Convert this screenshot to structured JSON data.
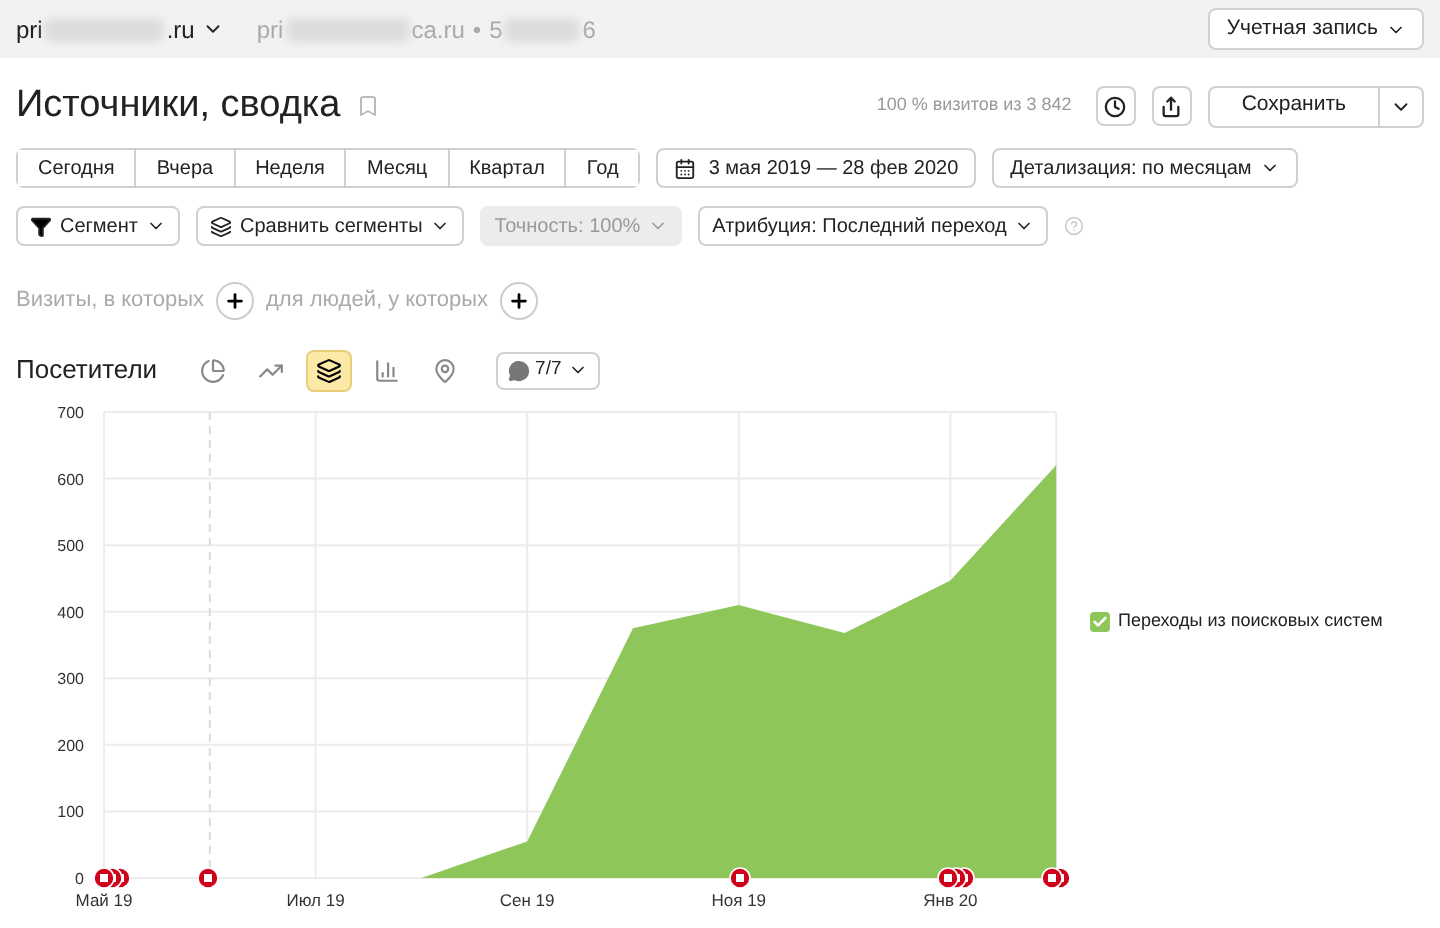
{
  "top_bar": {
    "site": {
      "prefix": "pri",
      "suffix": ".ru"
    },
    "other_site": {
      "prefix": "pri",
      "suffix": "ca.ru",
      "separator": "•",
      "id_prefix": "5",
      "id_suffix": "6"
    },
    "account_button": "Учетная запись"
  },
  "header": {
    "title": "Источники, сводка",
    "visits_info": "100 % визитов из 3 842",
    "save_button": "Сохранить"
  },
  "periods": [
    {
      "label": "Сегодня",
      "selected": false
    },
    {
      "label": "Вчера",
      "selected": false
    },
    {
      "label": "Неделя",
      "selected": false
    },
    {
      "label": "Месяц",
      "selected": false
    },
    {
      "label": "Квартал",
      "selected": false
    },
    {
      "label": "Год",
      "selected": false
    }
  ],
  "date_range": "3 мая 2019 — 28 фев 2020",
  "detail_dropdown": "Детализация: по месяцам",
  "filters": [
    {
      "label": "Сегмент",
      "disabled": false
    },
    {
      "label": "Сравнить сегменты",
      "disabled": false
    },
    {
      "label": "Точность: 100%",
      "disabled": true
    },
    {
      "label": "Атрибуция: Последний переход",
      "disabled": false
    }
  ],
  "segment_builder": {
    "visits_label": "Визиты, в которых",
    "people_label": "для людей, у которых"
  },
  "chart_toolbar": {
    "title": "Посетители",
    "views": [
      {
        "kind": "pie",
        "selected": false
      },
      {
        "kind": "line",
        "selected": false
      },
      {
        "kind": "area",
        "selected": true
      },
      {
        "kind": "bar",
        "selected": false
      },
      {
        "kind": "map",
        "selected": false
      }
    ],
    "notes_count": "7/7"
  },
  "chart": {
    "chart_data": {
      "type": "area",
      "categories": [
        "Май 19",
        null,
        "Июл 19",
        null,
        "Сен 19",
        null,
        "Ноя 19",
        null,
        "Янв 20",
        null
      ],
      "series": [
        {
          "name": "Переходы из поисковых систем",
          "color": "#8fc65a",
          "values": [
            null,
            null,
            null,
            0,
            55,
            375,
            410,
            368,
            447,
            620
          ]
        }
      ],
      "ylim": [
        0,
        700
      ],
      "grid": true,
      "yticks": [
        0,
        100,
        200,
        300,
        400,
        500,
        600,
        700
      ]
    },
    "legend": [
      {
        "checked": true
      }
    ]
  }
}
